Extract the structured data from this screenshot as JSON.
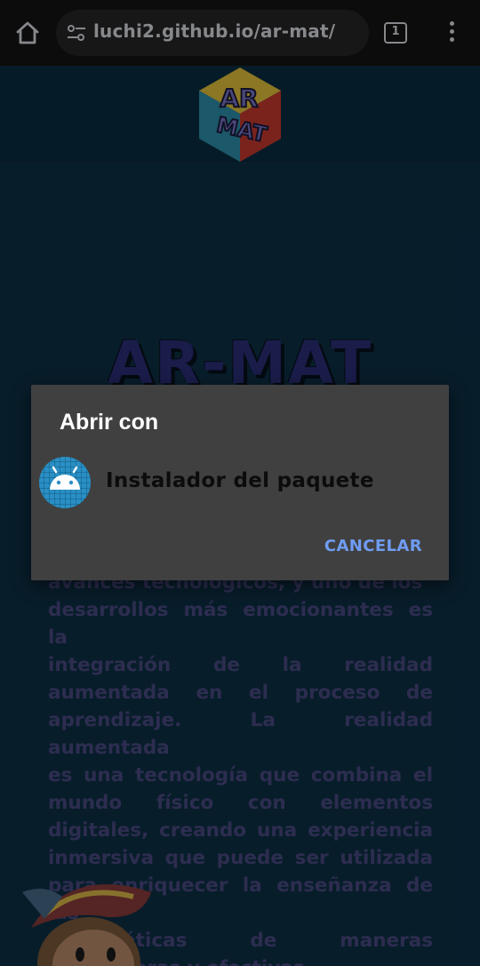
{
  "browser": {
    "url": "luchi2.github.io/ar-mat/",
    "tab_count": "1",
    "icons": {
      "home": "home-icon",
      "site_info": "tune-icon",
      "tabs": "tab-switcher-icon",
      "menu": "more-vert-icon"
    }
  },
  "page": {
    "logo_text_top": "AR",
    "logo_text_bottom": "MAT",
    "hero_title": "AR-MAT",
    "body_lines": [
      "avances tecnológicos, y uno de los",
      "desarrollos más emocionantes es la",
      "integración de la realidad",
      "aumentada en el proceso de",
      "aprendizaje. La realidad aumentada",
      "es una tecnología que combina el",
      "mundo físico con elementos",
      "digitales, creando una experiencia",
      "inmersiva que puede ser utilizada",
      "para enriquecer la enseñanza de las",
      "matemáticas de maneras",
      "innovadoras y efectivas."
    ]
  },
  "dialog": {
    "title": "Abrir con",
    "option_label": "Instalador del paquete",
    "option_icon": "android-icon",
    "cancel_label": "CANCELAR"
  },
  "colors": {
    "page_bg": "#0d2f45",
    "dialog_bg": "#404040",
    "accent": "#6f9cf3"
  }
}
